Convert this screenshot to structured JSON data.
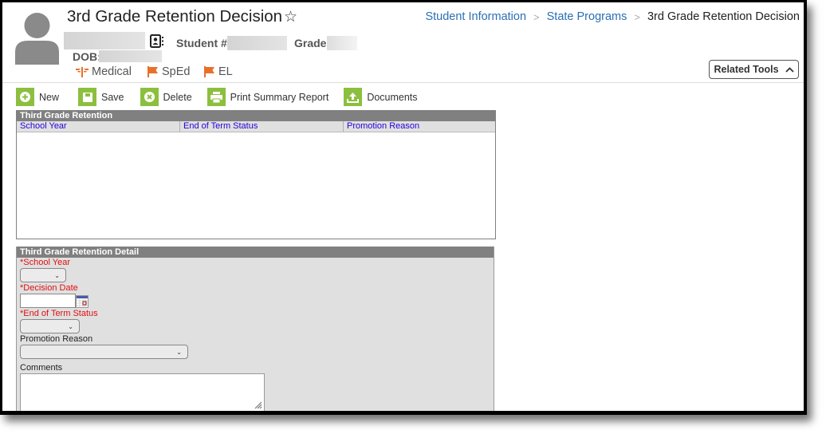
{
  "header": {
    "title": "3rd Grade Retention Decision",
    "student_number_label": "Student #:",
    "grade_label": "Grade:",
    "dob_label": "DOB:",
    "flags": [
      {
        "label": "Medical",
        "icon": "medical-icon",
        "color": "#e8702a"
      },
      {
        "label": "SpEd",
        "icon": "flag-icon",
        "color": "#e8702a"
      },
      {
        "label": "EL",
        "icon": "flag-icon",
        "color": "#e8702a"
      }
    ]
  },
  "breadcrumb": {
    "items": [
      "Student Information",
      "State Programs"
    ],
    "current": "3rd Grade Retention Decision"
  },
  "related_tools": {
    "label": "Related Tools"
  },
  "toolbar": {
    "new_label": "New",
    "save_label": "Save",
    "delete_label": "Delete",
    "print_label": "Print Summary Report",
    "documents_label": "Documents"
  },
  "list": {
    "title": "Third Grade Retention",
    "columns": [
      "School Year",
      "End of Term Status",
      "Promotion Reason"
    ],
    "rows": []
  },
  "detail": {
    "title": "Third Grade Retention Detail",
    "school_year_label": "*School Year",
    "school_year_value": "",
    "decision_date_label": "*Decision Date",
    "decision_date_value": "",
    "end_status_label": "*End of Term Status",
    "end_status_value": "",
    "promotion_reason_label": "Promotion Reason",
    "promotion_reason_value": "",
    "comments_label": "Comments",
    "comments_value": ""
  },
  "colors": {
    "accent_green": "#8cbf3f",
    "link_blue": "#2a6fb4",
    "required_red": "#e01010",
    "panel_header": "#808080"
  }
}
